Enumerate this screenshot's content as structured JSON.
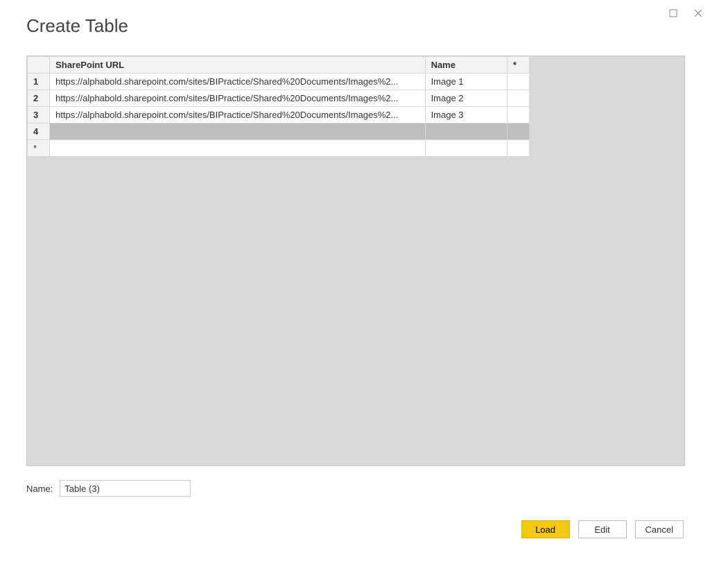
{
  "window": {
    "title": "Create Table"
  },
  "grid": {
    "headers": {
      "url": "SharePoint URL",
      "name": "Name",
      "star": "*"
    },
    "rows": [
      {
        "num": "1",
        "url": "https://alphabold.sharepoint.com/sites/BIPractice/Shared%20Documents/Images%2...",
        "name": "Image 1"
      },
      {
        "num": "2",
        "url": "https://alphabold.sharepoint.com/sites/BIPractice/Shared%20Documents/Images%2...",
        "name": "Image 2"
      },
      {
        "num": "3",
        "url": "https://alphabold.sharepoint.com/sites/BIPractice/Shared%20Documents/Images%2...",
        "name": "Image 3"
      },
      {
        "num": "4",
        "url": "",
        "name": ""
      }
    ],
    "new_row_marker": "*"
  },
  "name_field": {
    "label": "Name:",
    "value": "Table (3)"
  },
  "buttons": {
    "load": "Load",
    "edit": "Edit",
    "cancel": "Cancel"
  }
}
